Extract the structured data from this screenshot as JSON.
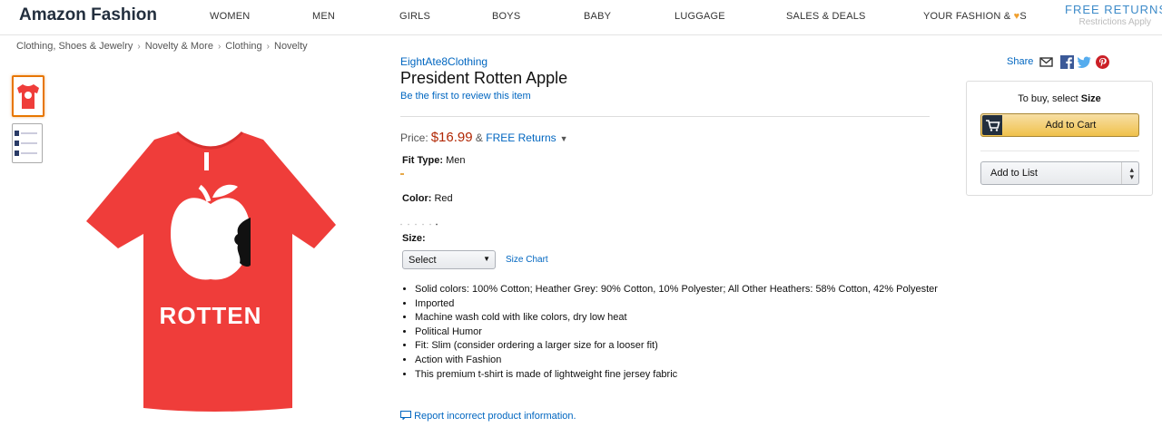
{
  "nav": {
    "brand": "Amazon Fashion",
    "items": [
      "WOMEN",
      "MEN",
      "GIRLS",
      "BOYS",
      "BABY",
      "LUGGAGE",
      "SALES & DEALS"
    ],
    "your_fashion_prefix": "YOUR FASHION &",
    "your_fashion_suffix": "S",
    "free_returns_title": "FREE RETURNS",
    "free_returns_sub": "Restrictions Apply"
  },
  "breadcrumb": [
    "Clothing, Shoes & Jewelry",
    "Novelty & More",
    "Clothing",
    "Novelty"
  ],
  "product": {
    "brand": "EightAte8Clothing",
    "title": "President Rotten Apple",
    "review_link": "Be the first to review this item",
    "price_label": "Price:",
    "price": "$16.99",
    "price_amp": "&",
    "free_returns": "FREE Returns",
    "fit_label": "Fit Type:",
    "fit_value": "Men",
    "color_label": "Color:",
    "color_value": "Red",
    "size_label": "Size:",
    "size_select": "Select",
    "size_chart": "Size Chart",
    "bullets": [
      "Solid colors: 100% Cotton; Heather Grey: 90% Cotton, 10% Polyester; All Other Heathers: 58% Cotton, 42% Polyester",
      "Imported",
      "Machine wash cold with like colors, dry low heat",
      "Political Humor",
      "Fit: Slim (consider ordering a larger size for a looser fit)",
      "Action with Fashion",
      "This premium t-shirt is made of lightweight fine jersey fabric"
    ],
    "report": "Report incorrect product information.",
    "shirt_text": "ROTTEN"
  },
  "share": {
    "label": "Share"
  },
  "buybox": {
    "to_buy_prefix": "To buy, select",
    "to_buy_strong": "Size",
    "add_to_cart": "Add to Cart",
    "add_to_list": "Add to List"
  },
  "colors": {
    "shirt": "#ef3d3a",
    "price": "#b12704",
    "link": "#0066c0",
    "cart_button": "#f0c14b"
  }
}
